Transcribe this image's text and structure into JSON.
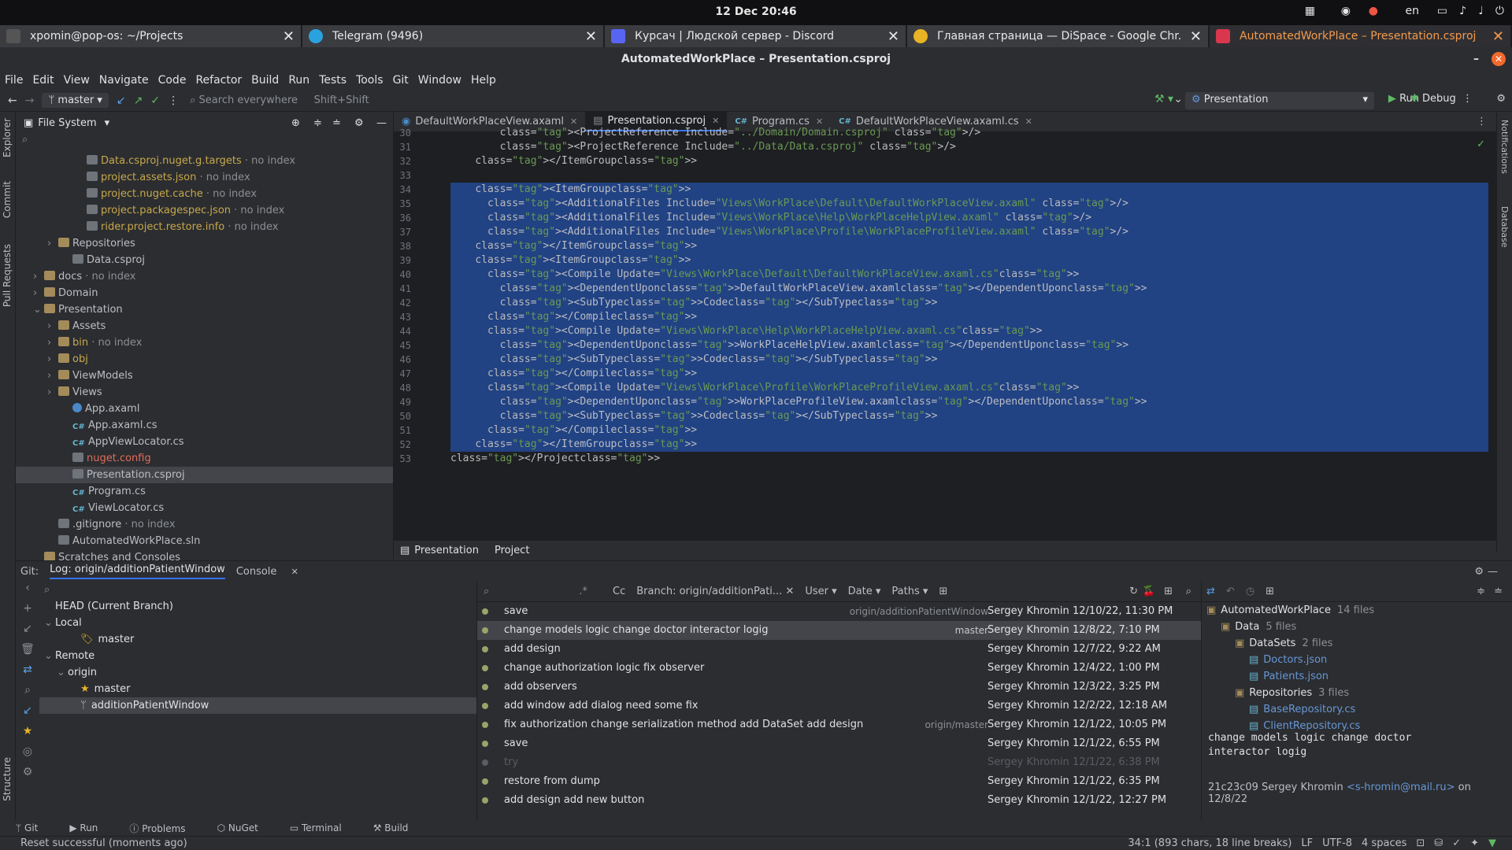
{
  "os": {
    "clock": "12 Dec  20:46",
    "lang": "en",
    "tabs": [
      {
        "label": "xpomin@pop-os: ~/Projects",
        "color": "#555"
      },
      {
        "label": "Telegram (9496)",
        "color": "#2aa2e0"
      },
      {
        "label": "Курсач | Людской сервер - Discord",
        "color": "#5865f2"
      },
      {
        "label": "Главная страница — DiSpace - Google Chr...",
        "color": "#e8b325"
      },
      {
        "label": "AutomatedWorkPlace – Presentation.csproj",
        "color": "#d8374d"
      }
    ]
  },
  "window": {
    "title": "AutomatedWorkPlace – Presentation.csproj"
  },
  "menu": [
    "File",
    "Edit",
    "View",
    "Navigate",
    "Code",
    "Refactor",
    "Build",
    "Run",
    "Tests",
    "Tools",
    "Git",
    "Window",
    "Help"
  ],
  "toolbar": {
    "branch": "master",
    "search_placeholder": "Search everywhere",
    "search_shortcut": "Shift+Shift",
    "run_config": "Presentation",
    "run": "Run",
    "debug": "Debug"
  },
  "side": {
    "explorer": "Explorer",
    "commit": "Commit",
    "pull_requests": "Pull Requests",
    "structure": "Structure",
    "notifications": "Notifications",
    "database": "Database"
  },
  "project": {
    "title": "File System",
    "tree": [
      {
        "indent": 4,
        "name": "Data.csproj.nuget.g.targets",
        "suffix": " · no index",
        "icon": "file",
        "cls": "yellow"
      },
      {
        "indent": 4,
        "name": "project.assets.json",
        "suffix": " · no index",
        "icon": "file",
        "cls": "yellow"
      },
      {
        "indent": 4,
        "name": "project.nuget.cache",
        "suffix": " · no index",
        "icon": "file",
        "cls": "yellow"
      },
      {
        "indent": 4,
        "name": "project.packagespec.json",
        "suffix": " · no index",
        "icon": "file",
        "cls": "yellow"
      },
      {
        "indent": 4,
        "name": "rider.project.restore.info",
        "suffix": " · no index",
        "icon": "file",
        "cls": "yellow"
      },
      {
        "indent": 2,
        "arrow": "›",
        "name": "Repositories",
        "suffix": "",
        "icon": "folder",
        "cls": ""
      },
      {
        "indent": 3,
        "name": "Data.csproj",
        "suffix": "",
        "icon": "file",
        "cls": ""
      },
      {
        "indent": 1,
        "arrow": "›",
        "name": "docs",
        "suffix": " · no index",
        "icon": "folder",
        "cls": ""
      },
      {
        "indent": 1,
        "arrow": "›",
        "name": "Domain",
        "suffix": "",
        "icon": "folder",
        "cls": ""
      },
      {
        "indent": 1,
        "arrow": "⌄",
        "name": "Presentation",
        "suffix": "",
        "icon": "folder",
        "cls": ""
      },
      {
        "indent": 2,
        "arrow": "›",
        "name": "Assets",
        "suffix": "",
        "icon": "folder",
        "cls": ""
      },
      {
        "indent": 2,
        "arrow": "›",
        "name": "bin",
        "suffix": " · no index",
        "icon": "folder",
        "cls": "yellow"
      },
      {
        "indent": 2,
        "arrow": "›",
        "name": "obj",
        "suffix": "",
        "icon": "folder",
        "cls": "yellow"
      },
      {
        "indent": 2,
        "arrow": "›",
        "name": "ViewModels",
        "suffix": "",
        "icon": "folder",
        "cls": ""
      },
      {
        "indent": 2,
        "arrow": "›",
        "name": "Views",
        "suffix": "",
        "icon": "folder",
        "cls": ""
      },
      {
        "indent": 3,
        "name": "App.axaml",
        "suffix": "",
        "icon": "xaml",
        "cls": ""
      },
      {
        "indent": 3,
        "name": "App.axaml.cs",
        "suffix": "",
        "icon": "cs",
        "cls": ""
      },
      {
        "indent": 3,
        "name": "AppViewLocator.cs",
        "suffix": "",
        "icon": "cs",
        "cls": ""
      },
      {
        "indent": 3,
        "name": "nuget.config",
        "suffix": "",
        "icon": "file",
        "cls": "red"
      },
      {
        "indent": 3,
        "name": "Presentation.csproj",
        "suffix": "",
        "icon": "file",
        "cls": "",
        "sel": true
      },
      {
        "indent": 3,
        "name": "Program.cs",
        "suffix": "",
        "icon": "cs",
        "cls": ""
      },
      {
        "indent": 3,
        "name": "ViewLocator.cs",
        "suffix": "",
        "icon": "cs",
        "cls": ""
      },
      {
        "indent": 2,
        "name": ".gitignore",
        "suffix": " · no index",
        "icon": "file",
        "cls": ""
      },
      {
        "indent": 2,
        "name": "AutomatedWorkPlace.sln",
        "suffix": "",
        "icon": "file",
        "cls": ""
      },
      {
        "indent": 1,
        "name": "Scratches and Consoles",
        "suffix": "",
        "icon": "folder",
        "cls": ""
      }
    ]
  },
  "editor": {
    "tabs": [
      {
        "label": "DefaultWorkPlaceView.axaml",
        "active": false
      },
      {
        "label": "Presentation.csproj",
        "active": true
      },
      {
        "label": "Program.cs",
        "active": false
      },
      {
        "label": "DefaultWorkPlaceView.axaml.cs",
        "active": false
      }
    ],
    "lines": [
      {
        "n": "30",
        "code": "        <ProjectReference Include=\"../Domain/Domain.csproj\" />",
        "sel": false
      },
      {
        "n": "31",
        "code": "        <ProjectReference Include=\"../Data/Data.csproj\" />",
        "sel": false
      },
      {
        "n": "32",
        "code": "    </ItemGroup>",
        "sel": false
      },
      {
        "n": "33",
        "code": "",
        "sel": false
      },
      {
        "n": "34",
        "code": "    <ItemGroup>",
        "sel": true
      },
      {
        "n": "35",
        "code": "      <AdditionalFiles Include=\"Views\\WorkPlace\\Default\\DefaultWorkPlaceView.axaml\" />",
        "sel": true
      },
      {
        "n": "36",
        "code": "      <AdditionalFiles Include=\"Views\\WorkPlace\\Help\\WorkPlaceHelpView.axaml\" />",
        "sel": true
      },
      {
        "n": "37",
        "code": "      <AdditionalFiles Include=\"Views\\WorkPlace\\Profile\\WorkPlaceProfileView.axaml\" />",
        "sel": true
      },
      {
        "n": "38",
        "code": "    </ItemGroup>",
        "sel": true
      },
      {
        "n": "39",
        "code": "    <ItemGroup>",
        "sel": true
      },
      {
        "n": "40",
        "code": "      <Compile Update=\"Views\\WorkPlace\\Default\\DefaultWorkPlaceView.axaml.cs\">",
        "sel": true
      },
      {
        "n": "41",
        "code": "        <DependentUpon>DefaultWorkPlaceView.axaml</DependentUpon>",
        "sel": true
      },
      {
        "n": "42",
        "code": "        <SubType>Code</SubType>",
        "sel": true
      },
      {
        "n": "43",
        "code": "      </Compile>",
        "sel": true
      },
      {
        "n": "44",
        "code": "      <Compile Update=\"Views\\WorkPlace\\Help\\WorkPlaceHelpView.axaml.cs\">",
        "sel": true
      },
      {
        "n": "45",
        "code": "        <DependentUpon>WorkPlaceHelpView.axaml</DependentUpon>",
        "sel": true
      },
      {
        "n": "46",
        "code": "        <SubType>Code</SubType>",
        "sel": true
      },
      {
        "n": "47",
        "code": "      </Compile>",
        "sel": true
      },
      {
        "n": "48",
        "code": "      <Compile Update=\"Views\\WorkPlace\\Profile\\WorkPlaceProfileView.axaml.cs\">",
        "sel": true
      },
      {
        "n": "49",
        "code": "        <DependentUpon>WorkPlaceProfileView.axaml</DependentUpon>",
        "sel": true
      },
      {
        "n": "50",
        "code": "        <SubType>Code</SubType>",
        "sel": true
      },
      {
        "n": "51",
        "code": "      </Compile>",
        "sel": true
      },
      {
        "n": "52",
        "code": "    </ItemGroup>",
        "sel": true
      },
      {
        "n": "53",
        "code": "</Project>",
        "sel": false
      }
    ],
    "breadcrumb": [
      "Presentation",
      "Project"
    ]
  },
  "git": {
    "label": "Git:",
    "tab_log": "Log: origin/additionPatientWindow",
    "tab_console": "Console",
    "branches": [
      {
        "indent": 0,
        "arrow": "",
        "name": "HEAD (Current Branch)"
      },
      {
        "indent": 0,
        "arrow": "⌄",
        "name": "Local"
      },
      {
        "indent": 2,
        "arrow": "",
        "name": "master",
        "mark": "🏷"
      },
      {
        "indent": 0,
        "arrow": "⌄",
        "name": "Remote"
      },
      {
        "indent": 1,
        "arrow": "⌄",
        "name": "origin"
      },
      {
        "indent": 2,
        "arrow": "",
        "name": "master",
        "mark": "★"
      },
      {
        "indent": 2,
        "arrow": "",
        "name": "additionPatientWindow",
        "mark": "ᛘ",
        "sel": true
      }
    ],
    "filter": {
      "branch": "Branch: origin/additionPati...",
      "user": "User",
      "date": "Date",
      "paths": "Paths"
    },
    "commits": [
      {
        "msg": "save",
        "ref": "origin/additionPatientWindow",
        "author": "Sergey Khromin",
        "date": "12/10/22, 11:30 PM"
      },
      {
        "msg": "change models logic change doctor interactor logig",
        "ref": "master",
        "author": "Sergey Khromin",
        "date": "12/8/22, 7:10 PM",
        "sel": true
      },
      {
        "msg": "add design",
        "ref": "",
        "author": "Sergey Khromin",
        "date": "12/7/22, 9:22 AM"
      },
      {
        "msg": "change authorization logic fix observer",
        "ref": "",
        "author": "Sergey Khromin",
        "date": "12/4/22, 1:00 PM"
      },
      {
        "msg": "add observers",
        "ref": "",
        "author": "Sergey Khromin",
        "date": "12/3/22, 3:25 PM"
      },
      {
        "msg": "add window add dialog need some fix",
        "ref": "",
        "author": "Sergey Khromin",
        "date": "12/2/22, 12:18 AM"
      },
      {
        "msg": "fix authorization change serialization method add DataSet add design",
        "ref": "origin/master",
        "author": "Sergey Khromin",
        "date": "12/1/22, 10:05 PM"
      },
      {
        "msg": "save",
        "ref": "",
        "author": "Sergey Khromin",
        "date": "12/1/22, 6:55 PM"
      },
      {
        "msg": "try",
        "ref": "",
        "author": "Sergey Khromin",
        "date": "12/1/22, 6:38 PM",
        "dim": true
      },
      {
        "msg": "restore from dump",
        "ref": "",
        "author": "Sergey Khromin",
        "date": "12/1/22, 6:35 PM"
      },
      {
        "msg": "add design add new button",
        "ref": "",
        "author": "Sergey Khromin",
        "date": "12/1/22, 12:27 PM"
      }
    ],
    "changes": [
      {
        "indent": 0,
        "name": "AutomatedWorkPlace",
        "count": "14 files",
        "blue": false
      },
      {
        "indent": 1,
        "name": "Data",
        "count": "5 files",
        "blue": false
      },
      {
        "indent": 2,
        "name": "DataSets",
        "count": "2 files",
        "blue": false
      },
      {
        "indent": 3,
        "name": "Doctors.json",
        "count": "",
        "blue": true
      },
      {
        "indent": 3,
        "name": "Patients.json",
        "count": "",
        "blue": true
      },
      {
        "indent": 2,
        "name": "Repositories",
        "count": "3 files",
        "blue": false
      },
      {
        "indent": 3,
        "name": "BaseRepository.cs",
        "count": "",
        "blue": true
      },
      {
        "indent": 3,
        "name": "ClientRepository.cs",
        "count": "",
        "blue": true
      }
    ],
    "commit_msg_line1": "change models logic change doctor",
    "commit_msg_line2": "interactor logig",
    "commit_hash_author": "21c23c09 Sergey Khromin",
    "commit_email": "<s-hromin@mail.ru>",
    "commit_on": "on 12/8/22"
  },
  "tools": [
    "Git",
    "Run",
    "Problems",
    "NuGet",
    "Terminal",
    "Build"
  ],
  "status": {
    "message": "Reset successful (moments ago)",
    "position": "34:1 (893 chars, 18 line breaks)",
    "eol": "LF",
    "encoding": "UTF-8",
    "indent": "4 spaces"
  }
}
